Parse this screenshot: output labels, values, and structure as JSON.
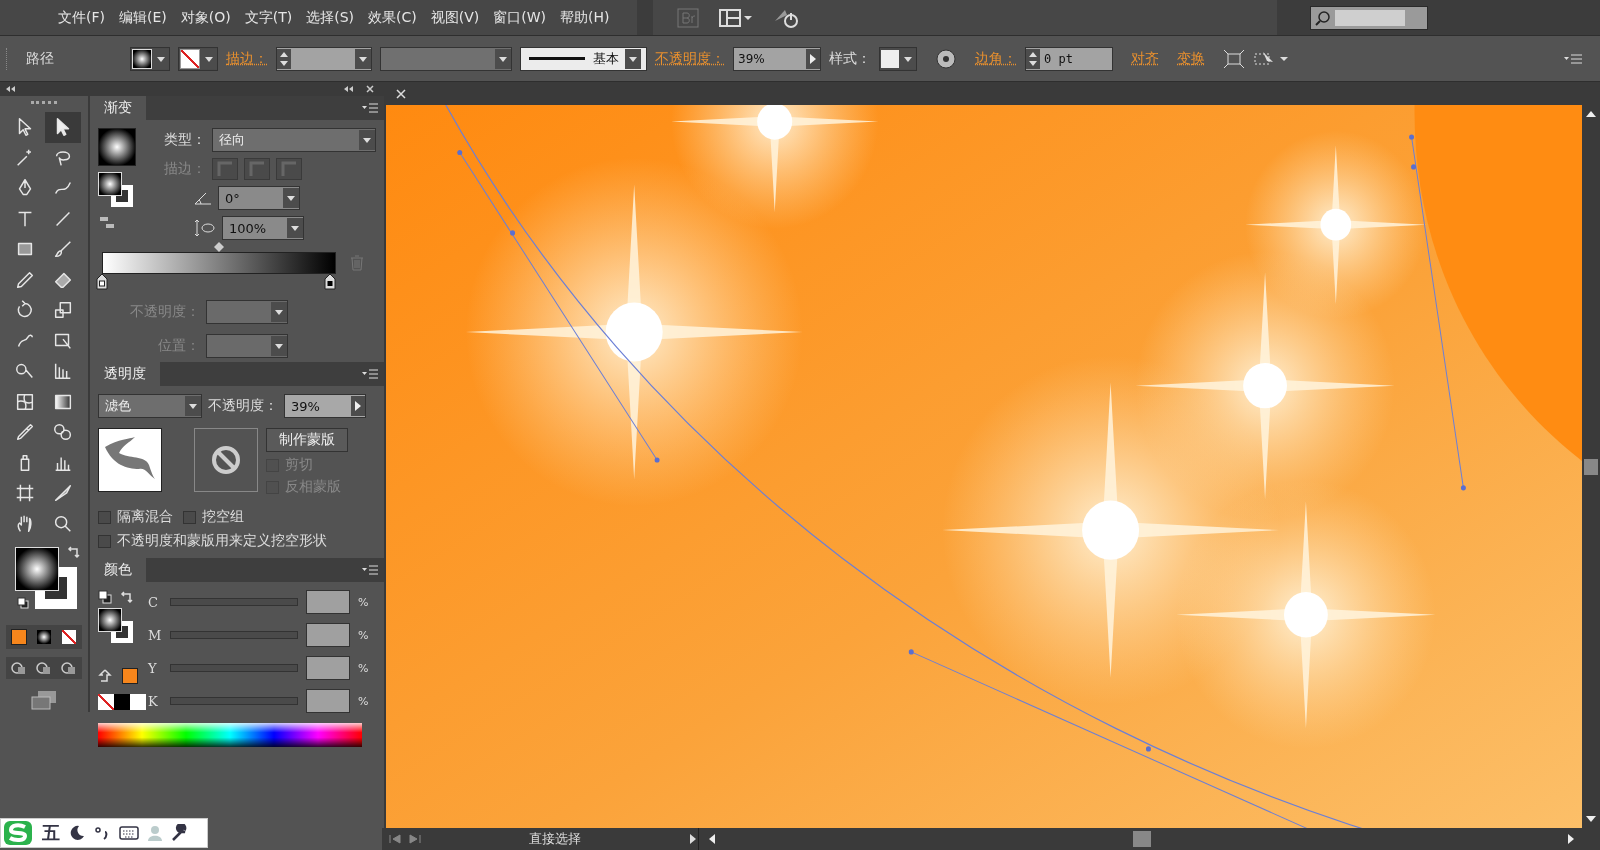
{
  "menu": [
    "文件(F)",
    "编辑(E)",
    "对象(O)",
    "文字(T)",
    "选择(S)",
    "效果(C)",
    "视图(V)",
    "窗口(W)",
    "帮助(H)"
  ],
  "control_bar": {
    "selection": "路径",
    "stroke_label": "描边：",
    "stroke_profile": "基本",
    "opacity_label": "不透明度：",
    "opacity": "39%",
    "style_label": "样式：",
    "corner_label": "边角：",
    "corner": "0 pt",
    "align": "对齐",
    "transform": "变换"
  },
  "tools": [
    {
      "kind": "select",
      "selected": false
    },
    {
      "kind": "direct",
      "selected": true
    },
    {
      "kind": "wand",
      "selected": false
    },
    {
      "kind": "lasso",
      "selected": false
    },
    {
      "kind": "pen",
      "selected": false
    },
    {
      "kind": "curvature",
      "selected": false
    },
    {
      "kind": "type",
      "selected": false
    },
    {
      "kind": "line",
      "selected": false
    },
    {
      "kind": "rectangle",
      "selected": false
    },
    {
      "kind": "brush",
      "selected": false
    },
    {
      "kind": "pencil",
      "selected": false
    },
    {
      "kind": "eraser",
      "selected": false
    },
    {
      "kind": "rotate",
      "selected": false
    },
    {
      "kind": "scale",
      "selected": false
    },
    {
      "kind": "puppet",
      "selected": false
    },
    {
      "kind": "free",
      "selected": false
    },
    {
      "kind": "shapebuilder",
      "selected": false
    },
    {
      "kind": "perspective",
      "selected": false
    },
    {
      "kind": "mesh",
      "selected": false
    },
    {
      "kind": "gradient",
      "selected": false
    },
    {
      "kind": "eyedropper",
      "selected": false
    },
    {
      "kind": "blend",
      "selected": false
    },
    {
      "kind": "sprayer",
      "selected": false
    },
    {
      "kind": "graph",
      "selected": false
    },
    {
      "kind": "artboard",
      "selected": false
    },
    {
      "kind": "slice",
      "selected": false
    },
    {
      "kind": "hand",
      "selected": false
    },
    {
      "kind": "zoom",
      "selected": false
    }
  ],
  "gradient_panel": {
    "title": "渐变",
    "type_label": "类型：",
    "type": "径向",
    "stroke_label": "描边：",
    "angle": "0°",
    "aspect": "100%",
    "opacity_label": "不透明度：",
    "location_label": "位置："
  },
  "transparency_panel": {
    "title": "透明度",
    "blend_mode": "滤色",
    "opacity_label": "不透明度：",
    "opacity": "39%",
    "make_mask": "制作蒙版",
    "mask_options": [
      {
        "label": "剪切",
        "checked": false,
        "disabled": true
      },
      {
        "label": "反相蒙版",
        "checked": false,
        "disabled": true
      }
    ],
    "options": [
      {
        "label": "隔离混合",
        "checked": false
      },
      {
        "label": "挖空组",
        "checked": false
      },
      {
        "label": "不透明度和蒙版用来定义挖空形状",
        "checked": false
      }
    ]
  },
  "color_panel": {
    "title": "颜色",
    "channels": [
      {
        "name": "C",
        "unit": "%"
      },
      {
        "name": "M",
        "unit": "%"
      },
      {
        "name": "Y",
        "unit": "%"
      },
      {
        "name": "K",
        "unit": "%"
      }
    ]
  },
  "status_bar": {
    "tool": "直接选择"
  },
  "ime_bar": {
    "mode": "五"
  }
}
